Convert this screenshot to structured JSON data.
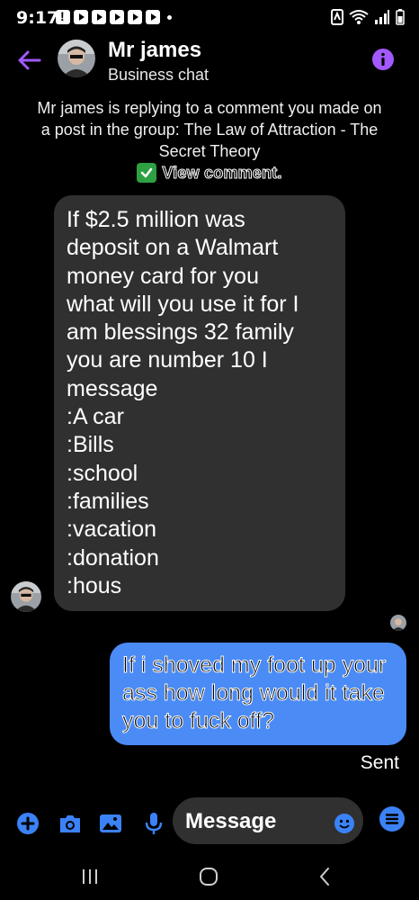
{
  "status_bar": {
    "time": "9:17"
  },
  "header": {
    "name": "Mr james",
    "subtitle": "Business chat"
  },
  "notice": {
    "text": "Mr james is replying to a comment you made on a post in the group: The Law of Attraction - The Secret Theory",
    "link": "View comment."
  },
  "messages": {
    "incoming_text": "If $2.5 million was\ndeposit on a Walmart\nmoney card  for you\nwhat will you use it for I\nam blessings 32 family\nyou are number 10 I\nmessage\n:A car\n:Bills\n:school\n:families\n:vacation\n:donation\n:hous",
    "outgoing_text": "If i shoved my foot up your ass how long would it take you to fuck off?",
    "sent_label": "Sent"
  },
  "composer": {
    "placeholder": "Message"
  },
  "colors": {
    "accent": "#a259ff",
    "outgoing_bubble": "#4b8bf5",
    "incoming_bubble": "#303030",
    "composer_icons": "#3b82f6"
  },
  "icons": [
    "back-arrow-icon",
    "info-icon",
    "plus-icon",
    "camera-icon",
    "image-icon",
    "microphone-icon",
    "emoji-icon",
    "menu-icon",
    "recents-icon",
    "home-icon",
    "back-icon"
  ]
}
